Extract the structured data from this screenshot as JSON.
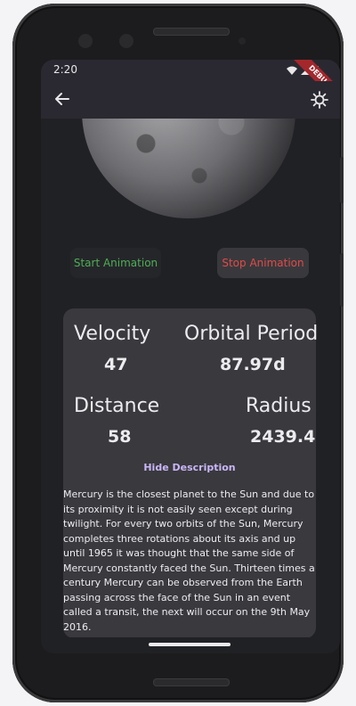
{
  "status_bar": {
    "time": "2:20",
    "debug_label": "DEBUG"
  },
  "app_bar": {
    "back_icon": "arrow-back-icon",
    "theme_icon": "brightness-icon"
  },
  "planet_image": "mercury",
  "controls": {
    "start_label": "Start Animation",
    "stop_label": "Stop Animation",
    "start_color": "#4fae55",
    "stop_color": "#e04b48"
  },
  "stats": {
    "velocity": {
      "label": "Velocity",
      "value": "47"
    },
    "orbital_period": {
      "label": "Orbital Period",
      "value": "87.97d"
    },
    "distance": {
      "label": "Distance",
      "value": "58"
    },
    "radius": {
      "label": "Radius",
      "value": "2439.4"
    }
  },
  "description": {
    "toggle_label": "Hide Description",
    "text": "Mercury is the closest planet to the Sun and due to its proximity it is not easily seen except during twilight. For every two orbits of the Sun, Mercury completes three rotations about its axis and up until 1965 it was thought that the same side of Mercury constantly faced the Sun. Thirteen times a century Mercury can be observed from the Earth passing across the face of the Sun in an event called a transit, the next will occur on the 9th May 2016."
  },
  "colors": {
    "accent": "#c9b6f7",
    "background": "#202124",
    "card": "#3a393e"
  }
}
